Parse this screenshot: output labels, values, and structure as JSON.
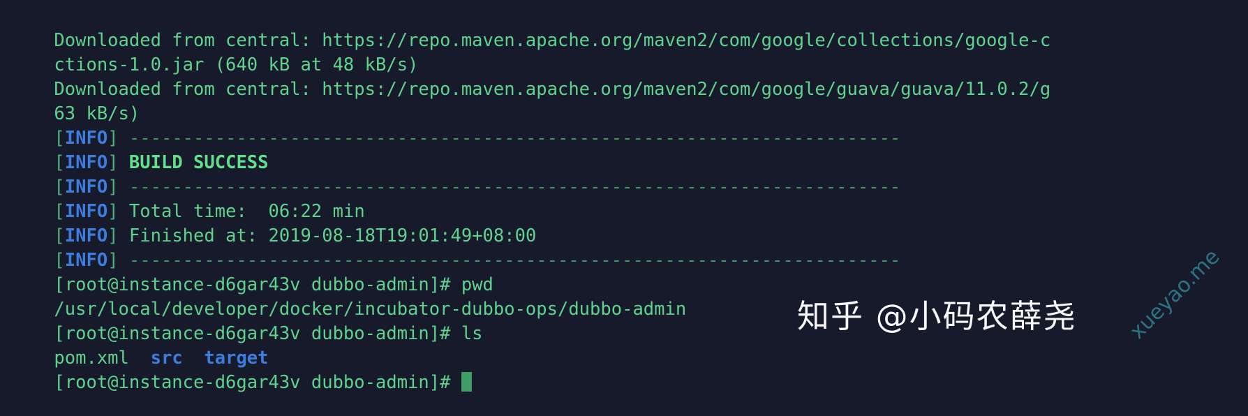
{
  "terminal": {
    "background_color": "#161a2b",
    "foreground_color": "#5fd38d",
    "info_label_color": "#3c7ddd",
    "success_color": "#63e08c",
    "dir_color": "#3c7ddd",
    "cursor_color": "#3f9e66",
    "prompt": "[root@instance-d6gar43v dubbo-admin]#",
    "lines": {
      "download_1": "Downloaded from central: https://repo.maven.apache.org/maven2/com/google/collections/google-c",
      "download_1_cont": "ctions-1.0.jar (640 kB at 48 kB/s)",
      "download_2": "Downloaded from central: https://repo.maven.apache.org/maven2/com/google/guava/guava/11.0.2/g",
      "download_2_cont": "63 kB/s)",
      "info_tag": "INFO",
      "bracket_open": "[",
      "bracket_close": "]",
      "separator": "------------------------------------------------------------------------",
      "build_success": "BUILD SUCCESS",
      "total_time": "Total time:  06:22 min",
      "finished_at": "Finished at: 2019-08-18T19:01:49+08:00",
      "cmd_pwd": "pwd",
      "pwd_output": "/usr/local/developer/docker/incubator-dubbo-ops/dubbo-admin",
      "cmd_ls": "ls",
      "ls_file_pom": "pom.xml",
      "ls_dir_src": "src",
      "ls_dir_target": "target",
      "ls_gap": "  ",
      "space": " "
    }
  },
  "watermark": {
    "text": "知乎 @小码农薛尧",
    "diagonal_text": "xueyao.me",
    "text_color": "#ffffff",
    "diagonal_color": "#2e7c8c"
  }
}
